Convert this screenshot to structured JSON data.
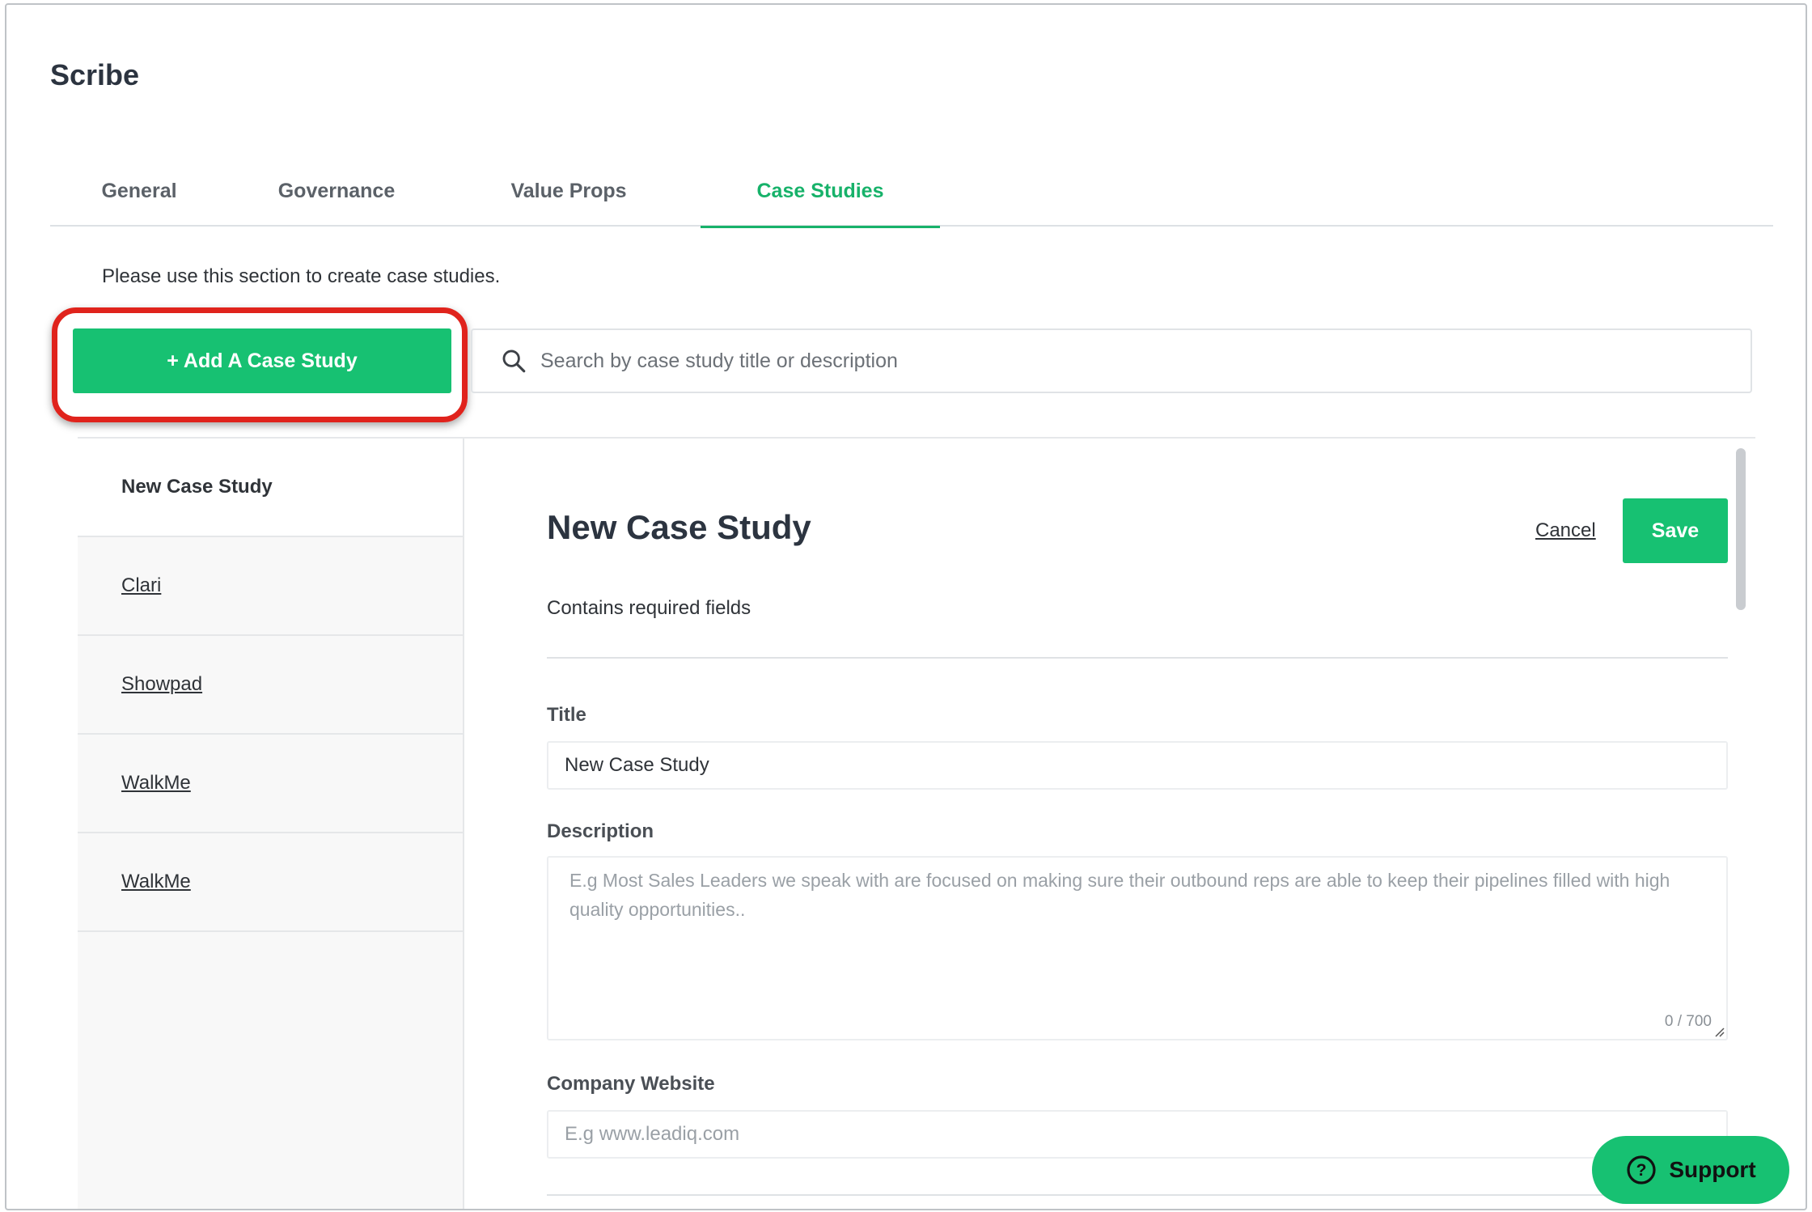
{
  "app": {
    "title": "Scribe"
  },
  "tabs": [
    {
      "label": "General"
    },
    {
      "label": "Governance"
    },
    {
      "label": "Value Props"
    },
    {
      "label": "Case Studies"
    }
  ],
  "active_tab": "Case Studies",
  "intro_text": "Please use this section to create case studies.",
  "toolbar": {
    "add_label": "+ Add A Case Study",
    "search_placeholder": "Search by case study title or description"
  },
  "sidebar": {
    "items": [
      {
        "label": "New Case Study"
      },
      {
        "label": "Clari"
      },
      {
        "label": "Showpad"
      },
      {
        "label": "WalkMe"
      },
      {
        "label": "WalkMe"
      }
    ]
  },
  "editor": {
    "title": "New Case Study",
    "cancel_label": "Cancel",
    "save_label": "Save",
    "required_note": "Contains required fields",
    "fields": {
      "title": {
        "label": "Title",
        "value": "New Case Study"
      },
      "description": {
        "label": "Description",
        "placeholder": "E.g Most Sales Leaders we speak with are focused on making sure their outbound reps are able to keep their pipelines filled with high quality opportunities..",
        "char_count": "0 / 700"
      },
      "website": {
        "label": "Company Website",
        "placeholder": "E.g www.leadiq.com"
      }
    }
  },
  "support": {
    "label": "Support"
  },
  "colors": {
    "accent": "#17c172",
    "active_tab": "#17b26a",
    "highlight": "#e0231c"
  }
}
